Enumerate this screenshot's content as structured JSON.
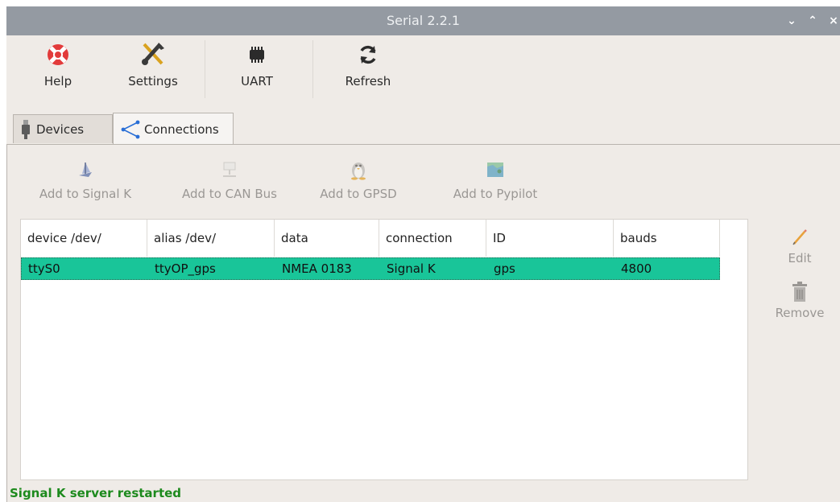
{
  "window": {
    "title": "Serial 2.2.1"
  },
  "titlebar_controls": {
    "minimize": "⌄",
    "maximize": "⌃",
    "close": "×"
  },
  "toolbar": {
    "help": "Help",
    "settings": "Settings",
    "uart": "UART",
    "refresh": "Refresh"
  },
  "tabs": [
    {
      "label": "Devices",
      "icon": "usb-plug-icon",
      "active": false
    },
    {
      "label": "Connections",
      "icon": "share-icon",
      "active": true
    }
  ],
  "actions": {
    "signalk": "Add to Signal K",
    "canbus": "Add to CAN Bus",
    "gpsd": "Add to GPSD",
    "pypilot": "Add to Pypilot"
  },
  "table": {
    "columns": [
      "device /dev/",
      "alias /dev/",
      "data",
      "connection",
      "ID",
      "bauds"
    ],
    "rows": [
      {
        "device": "ttyS0",
        "alias": "ttyOP_gps",
        "data": "NMEA 0183",
        "connection": "Signal K",
        "id": "gps",
        "bauds": "4800"
      }
    ]
  },
  "side_actions": {
    "edit": "Edit",
    "remove": "Remove"
  },
  "status": {
    "message": "Signal K server restarted"
  },
  "colors": {
    "titlebar": "#949aa2",
    "selection": "#19c599",
    "status_text": "#1d8a1d",
    "disabled_text": "#9a9794"
  }
}
